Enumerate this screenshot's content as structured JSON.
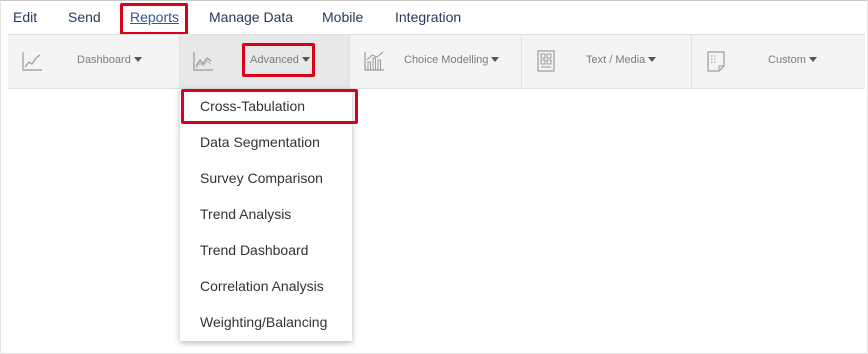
{
  "top_menu": {
    "items": [
      {
        "label": "Edit"
      },
      {
        "label": "Send"
      },
      {
        "label": "Reports"
      },
      {
        "label": "Manage Data"
      },
      {
        "label": "Mobile"
      },
      {
        "label": "Integration"
      }
    ],
    "active": "Reports"
  },
  "toolbar": {
    "groups": [
      {
        "label": "Dashboard",
        "icon": "line-chart-icon"
      },
      {
        "label": "Advanced",
        "icon": "trend-chart-icon"
      },
      {
        "label": "Choice Modelling",
        "icon": "bar-line-chart-icon"
      },
      {
        "label": "Text / Media",
        "icon": "document-grid-icon"
      },
      {
        "label": "Custom",
        "icon": "custom-report-icon"
      }
    ],
    "active": "Advanced"
  },
  "dropdown": {
    "items": [
      {
        "label": "Cross-Tabulation"
      },
      {
        "label": "Data Segmentation"
      },
      {
        "label": "Survey Comparison"
      },
      {
        "label": "Trend Analysis"
      },
      {
        "label": "Trend Dashboard"
      },
      {
        "label": "Correlation Analysis"
      },
      {
        "label": "Weighting/Balancing"
      }
    ]
  },
  "colors": {
    "highlight": "#d9001b",
    "menu_text": "#1f3a5c",
    "active_link": "#2c5aa0",
    "toolbar_bg": "#f4f4f4"
  }
}
